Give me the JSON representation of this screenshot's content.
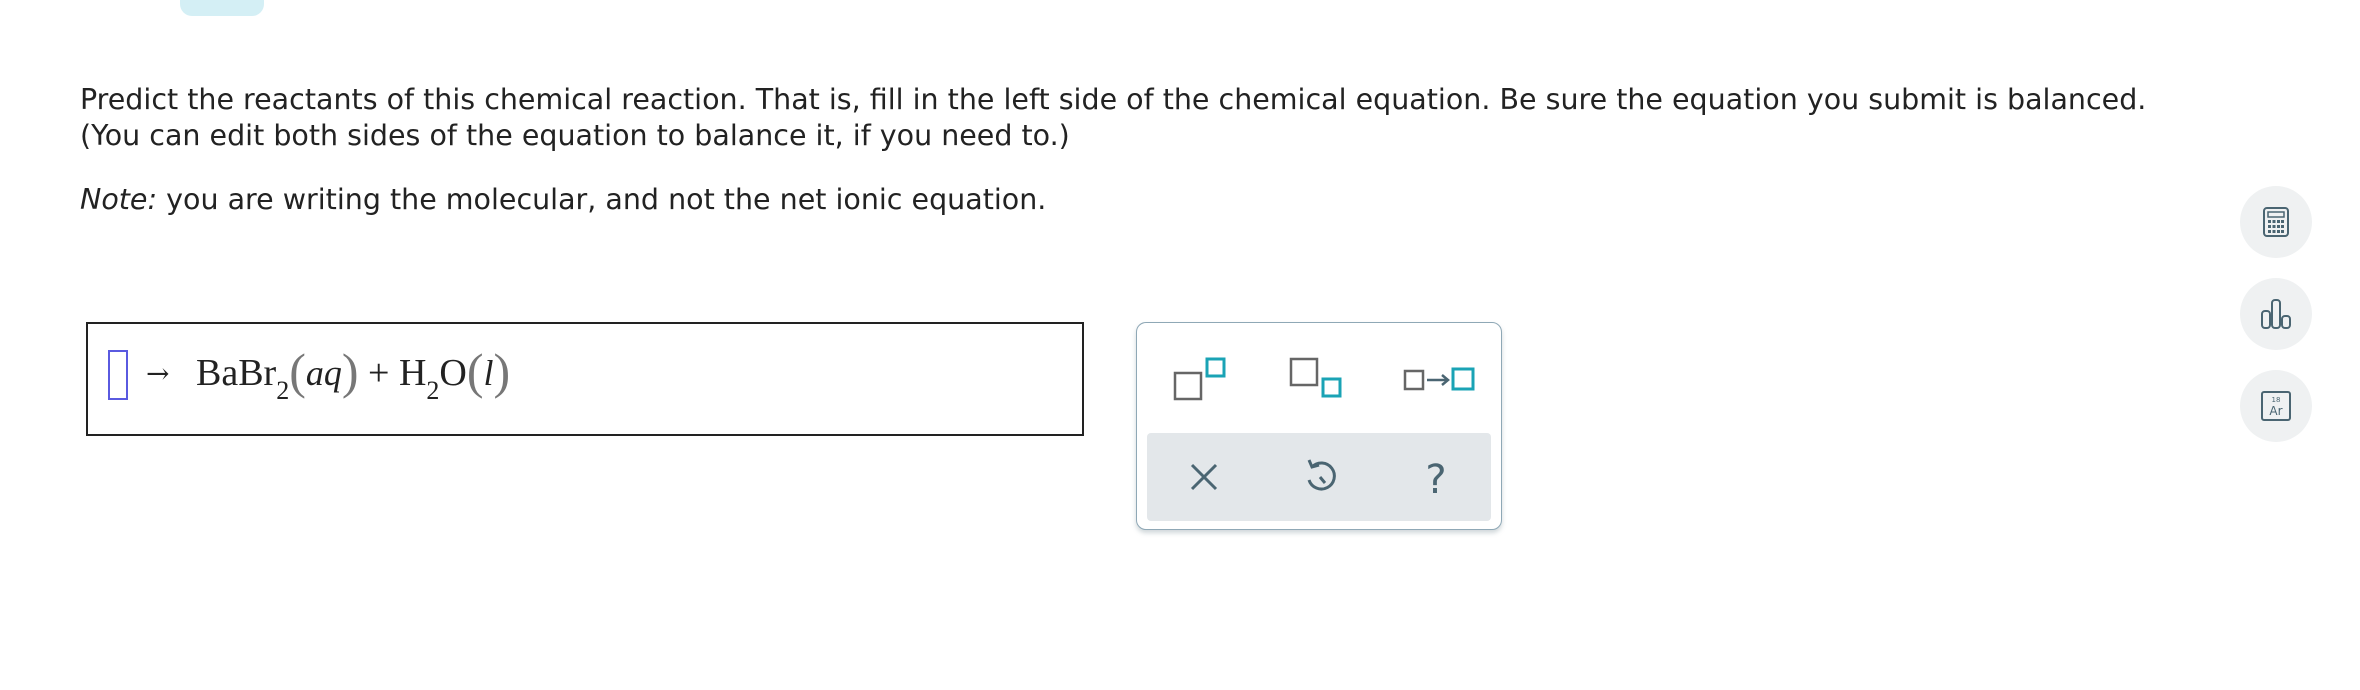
{
  "question": {
    "line1": "Predict the reactants of this chemical reaction. That is, fill in the left side of the chemical equation. Be sure the equation you submit is balanced.",
    "line2": "(You can edit both sides of the equation to balance it, if you need to.)",
    "note_label": "Note:",
    "note_text": " you are writing the molecular, and not the net ionic equation."
  },
  "equation": {
    "arrow": "→",
    "product1": "BaBr",
    "product1_sub": "2",
    "product1_state": "aq",
    "plus": "+",
    "product2_a": "H",
    "product2_sub": "2",
    "product2_b": "O",
    "product2_state": "l"
  },
  "palette": {
    "buttons": [
      "superscript-icon",
      "subscript-icon",
      "reaction-arrow-icon"
    ],
    "actions": [
      "clear-icon",
      "undo-icon",
      "help-icon"
    ],
    "help_symbol": "?"
  },
  "side_tools": {
    "periodic_number": "18",
    "periodic_symbol": "Ar"
  },
  "colors": {
    "accent_teal": "#1aa3b5",
    "cursor_blue": "#5a5ae0",
    "icon_gray": "#4a6572"
  }
}
